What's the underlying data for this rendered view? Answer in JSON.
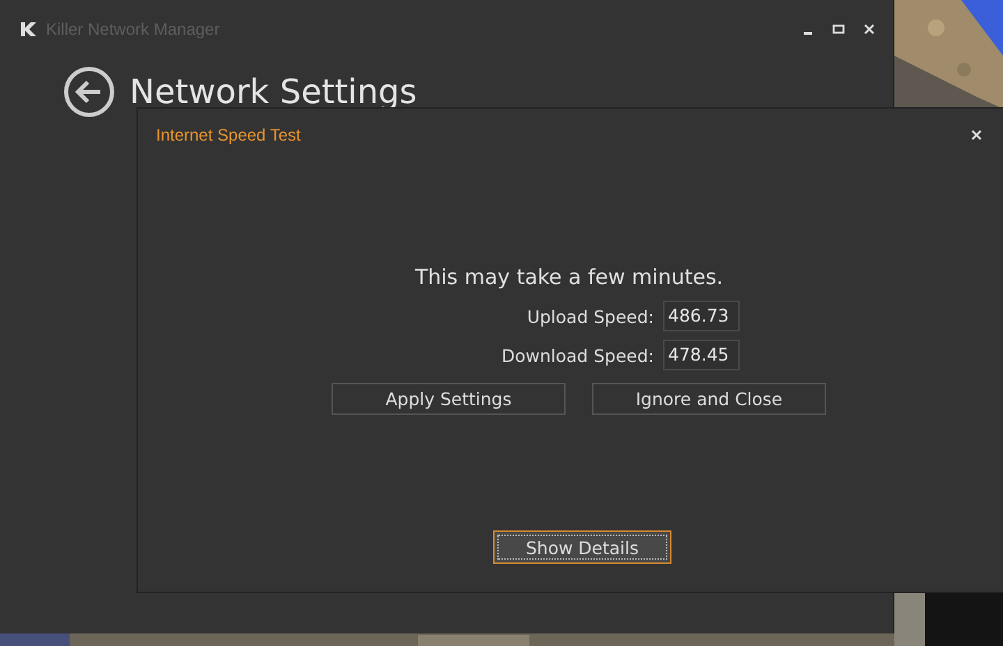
{
  "window": {
    "title": "Killer Network Manager",
    "heading": "Network Settings"
  },
  "dialog": {
    "title": "Internet Speed Test",
    "message": "This may take a few minutes.",
    "fields": [
      {
        "label": "Upload Speed:",
        "value": "486.73"
      },
      {
        "label": "Download Speed:",
        "value": "478.45"
      }
    ],
    "buttons": [
      "Apply Settings",
      "Ignore and Close"
    ],
    "details_button": "Show Details"
  }
}
